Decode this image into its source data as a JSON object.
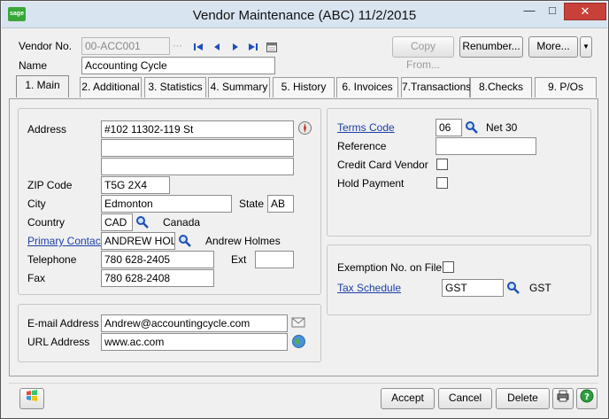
{
  "window": {
    "title": "Vendor Maintenance (ABC) 11/2/2015",
    "app_logo": "sage",
    "controls": {
      "minimize": "—",
      "maximize": "□",
      "close": "✕"
    }
  },
  "header": {
    "vendor_no_label": "Vendor No.",
    "vendor_no_value": "00-ACC001",
    "name_label": "Name",
    "name_value": "Accounting Cycle",
    "copy_from_label": "Copy From...",
    "renumber_label": "Renumber...",
    "more_label": "More...",
    "nav_icons": [
      "first-record-icon",
      "previous-record-icon",
      "next-record-icon",
      "last-record-icon",
      "lookup-list-icon"
    ]
  },
  "tabs": [
    {
      "label": "1. Main",
      "active": true
    },
    {
      "label": "2. Additional",
      "active": false
    },
    {
      "label": "3. Statistics",
      "active": false
    },
    {
      "label": "4. Summary",
      "active": false
    },
    {
      "label": "5. History",
      "active": false
    },
    {
      "label": "6. Invoices",
      "active": false
    },
    {
      "label": "7.Transactions",
      "active": false
    },
    {
      "label": "8.Checks",
      "active": false
    },
    {
      "label": "9. P/Os",
      "active": false
    }
  ],
  "address": {
    "address_label": "Address",
    "line1": "#102 11302-119 St",
    "line2": "",
    "line3": "",
    "zip_label": "ZIP Code",
    "zip_value": "T5G 2X4",
    "city_label": "City",
    "city_value": "Edmonton",
    "state_label": "State",
    "state_value": "AB",
    "country_label": "Country",
    "country_value": "CAD",
    "country_name": "Canada",
    "primary_contact_label": "Primary Contact",
    "primary_contact_value": "ANDREW HOL",
    "primary_contact_name": "Andrew Holmes",
    "telephone_label": "Telephone",
    "telephone_value": "780 628-2405",
    "ext_label": "Ext",
    "ext_value": "",
    "fax_label": "Fax",
    "fax_value": "780 628-2408"
  },
  "internet": {
    "email_label": "E-mail Address",
    "email_value": "Andrew@accountingcycle.com",
    "url_label": "URL Address",
    "url_value": "www.ac.com"
  },
  "terms": {
    "terms_code_label": "Terms Code",
    "terms_code_value": "06",
    "terms_desc": "Net 30",
    "reference_label": "Reference",
    "reference_value": "",
    "credit_card_label": "Credit Card Vendor",
    "credit_card_checked": false,
    "hold_payment_label": "Hold Payment",
    "hold_payment_checked": false
  },
  "tax": {
    "exemption_label": "Exemption No. on File",
    "exemption_checked": false,
    "tax_schedule_label": "Tax Schedule",
    "tax_schedule_value": "GST",
    "tax_schedule_desc": "GST"
  },
  "footer": {
    "accept_label": "Accept",
    "cancel_label": "Cancel",
    "delete_label": "Delete"
  },
  "colors": {
    "link": "#1b3fa8",
    "close_button": "#c7413a",
    "nav_arrows": "#1d4fb8"
  }
}
